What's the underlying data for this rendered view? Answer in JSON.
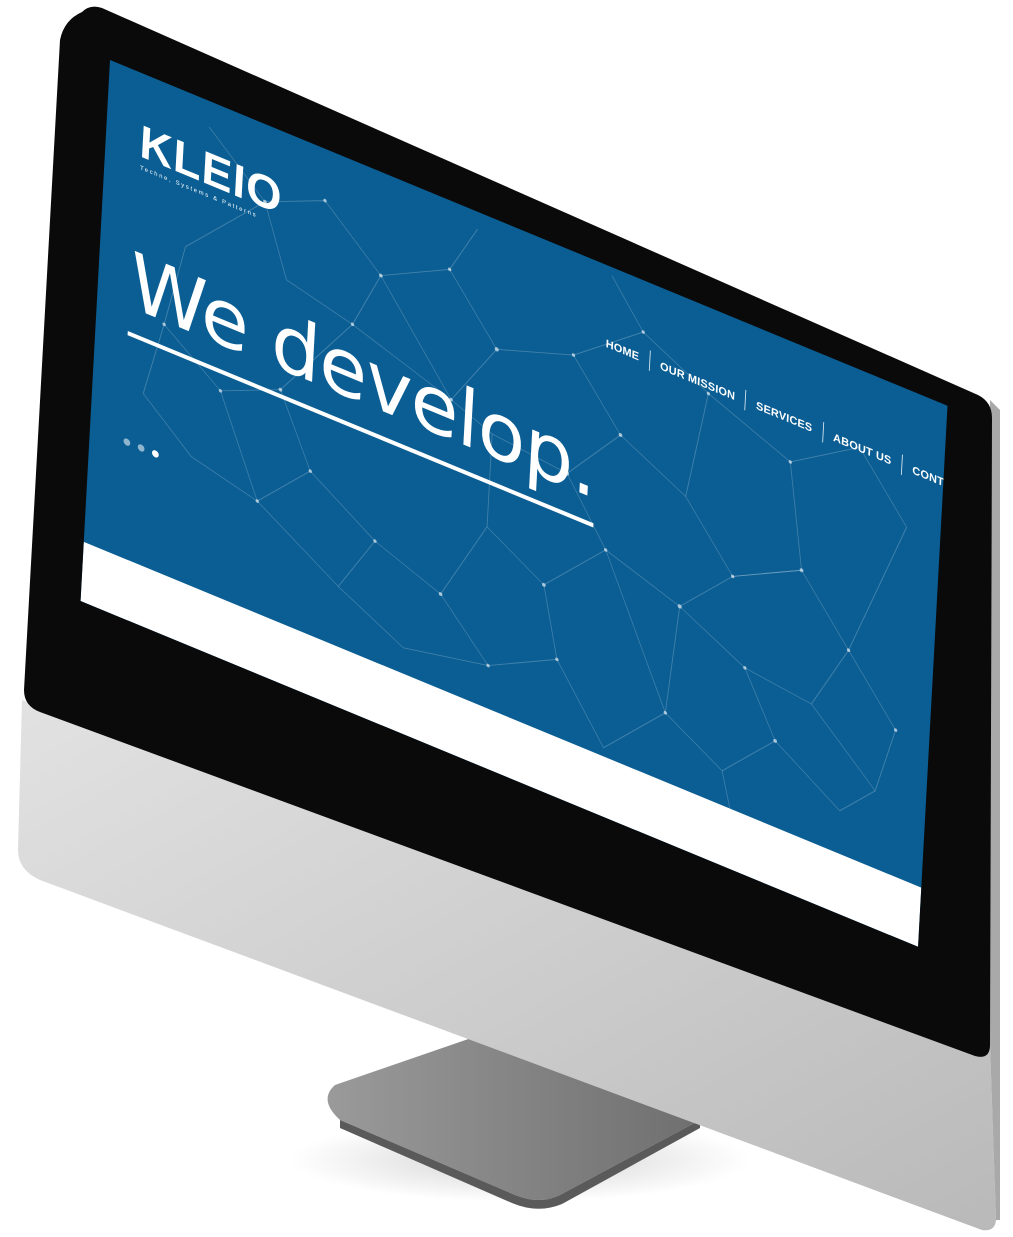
{
  "site": {
    "logo": {
      "mark": "KLEIO",
      "tagline": "Techne, Systems & Patterns"
    },
    "nav": {
      "items": [
        {
          "label": "HOME"
        },
        {
          "label": "OUR MISSION"
        },
        {
          "label": "SERVICES"
        },
        {
          "label": "ABOUT US"
        },
        {
          "label": "CONTACT"
        }
      ]
    },
    "hero": {
      "title": "We develop."
    },
    "slider": {
      "slide_count": 3,
      "active_index": 2
    }
  },
  "colors": {
    "brand_blue": "#0b5e94",
    "text": "#ffffff",
    "bezel": "#0a0a0a",
    "chin": "#cfcfcf",
    "stand": "#8a8a8a"
  }
}
